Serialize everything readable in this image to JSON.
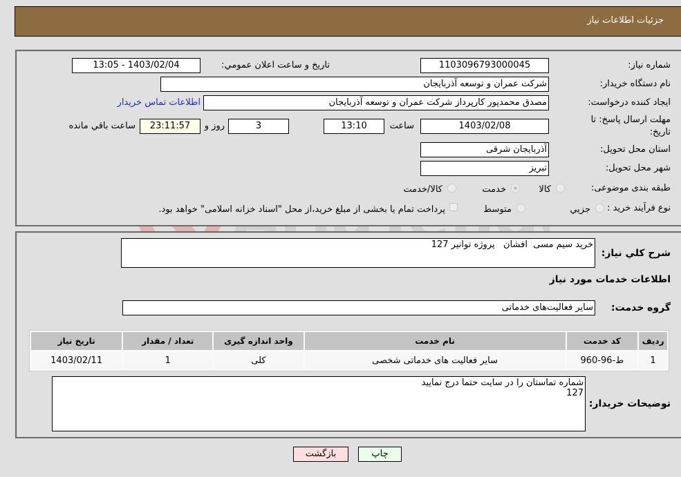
{
  "header": {
    "title": "جزئیات اطلاعات نیاز"
  },
  "details": {
    "need_number_label": "شماره نیاز:",
    "need_number": "1103096793000045",
    "announce_label": "تاریخ و ساعت اعلان عمومي:",
    "announce_value": "1403/02/04 - 13:05",
    "buyer_org_label": "نام دستگاه خریدار:",
    "buyer_org": "شرکت عمران و توسعه آذربایجان",
    "requester_label": "ایجاد کننده درخواست:",
    "requester": "مصدق محمدپور کارپرداز شرکت عمران و توسعه آذربایجان",
    "contact_link": "اطلاعات تماس خریدار",
    "deadline_label_line1": "مهلت ارسال پاسخ: تا",
    "deadline_label_line2": "تاریخ:",
    "deadline_date": "1403/02/08",
    "time_label": "ساعت",
    "deadline_time": "13:10",
    "days_value": "3",
    "days_label": "روز و",
    "remaining_time": "23:11:57",
    "remaining_label": "ساعت باقي مانده",
    "province_label": "استان محل تحویل:",
    "province": "آذربایجان شرقی",
    "city_label": "شهر محل تحویل:",
    "city": "تبریز",
    "category_label": "طبقه بندی موضوعی:",
    "category_options": [
      {
        "label": "کالا",
        "checked": false
      },
      {
        "label": "خدمت",
        "checked": true
      },
      {
        "label": "کالا/خدمت",
        "checked": false
      }
    ],
    "process_label": "نوع فرآیند خرید :",
    "process_options": [
      {
        "label": "جزیي",
        "checked": false
      },
      {
        "label": "متوسط",
        "checked": false
      }
    ],
    "treasury_note": "پرداخت تمام یا بخشی از مبلغ خرید،از محل \"اسناد خزانه اسلامی\" خواهد بود."
  },
  "services": {
    "summary_label": "شرح کلي نیاز:",
    "summary": "خرید سیم مسی  افشان   پروژه توانیر 127",
    "section_title": "اطلاعات خدمات مورد نیاز",
    "group_label": "گروه خدمت:",
    "group_value": "سایر فعالیت‌های خدماتی",
    "table": {
      "headers": [
        "ردیف",
        "کد خدمت",
        "نام خدمت",
        "واحد اندازه گیری",
        "تعداد / مقدار",
        "تاریخ نیاز"
      ],
      "rows": [
        [
          "1",
          "ط-96-960",
          "سایر فعالیت های خدماتی شخصی",
          "کلی",
          "1",
          "1403/02/11"
        ]
      ]
    },
    "buyer_notes_label": "توضیحات خریدار:",
    "buyer_notes": "شماره تماستان را در سایت حتما درج نمایید\n127"
  },
  "buttons": {
    "print": "چاپ",
    "back": "بازگشت"
  },
  "colors": {
    "header_bg": "#8d6c42",
    "print_bg": "#eaffea",
    "back_bg": "#ffdede",
    "link": "#2626c8"
  }
}
